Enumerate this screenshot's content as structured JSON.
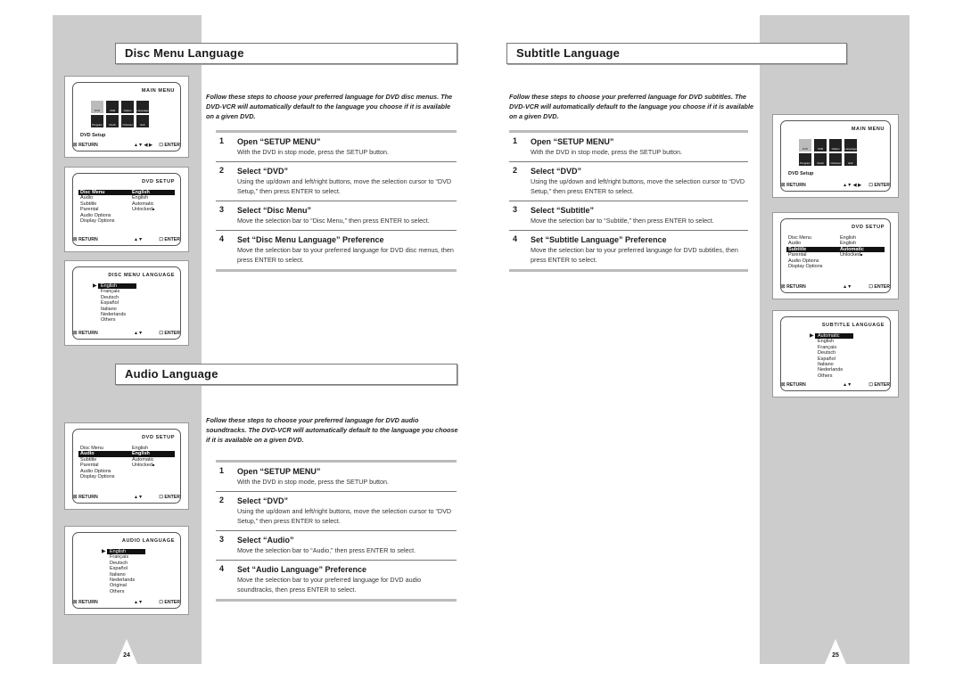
{
  "pages": [
    {
      "number": "24"
    },
    {
      "number": "25"
    }
  ],
  "sections": {
    "disc_menu": {
      "title": "Disc Menu Language",
      "intro": "Follow these steps to choose your preferred language for DVD disc menus. The DVD-VCR will automatically default to the language you choose if it is available on a given DVD.",
      "steps": [
        {
          "num": "1",
          "heading": "Open “SETUP MENU”",
          "text": "With the DVD in stop mode, press the SETUP button."
        },
        {
          "num": "2",
          "heading": "Select “DVD”",
          "text": "Using the up/down and left/right buttons, move the selection cursor to “DVD Setup,” then press ENTER to select."
        },
        {
          "num": "3",
          "heading": "Select “Disc Menu”",
          "text": "Move the selection bar to “Disc Menu,” then press ENTER to select."
        },
        {
          "num": "4",
          "heading": "Set “Disc Menu Language” Preference",
          "text": "Move the selection bar to your preferred language for DVD disc menus, then press ENTER to select."
        }
      ]
    },
    "audio": {
      "title": "Audio Language",
      "intro": "Follow these steps to choose your preferred language for DVD audio soundtracks. The DVD-VCR will automatically default to the language you choose if it is available on a given DVD.",
      "steps": [
        {
          "num": "1",
          "heading": "Open “SETUP MENU”",
          "text": "With the DVD in stop mode, press the SETUP button."
        },
        {
          "num": "2",
          "heading": "Select “DVD”",
          "text": "Using the up/down and left/right buttons, move the selection cursor to “DVD Setup,” then press ENTER to select."
        },
        {
          "num": "3",
          "heading": "Select “Audio”",
          "text": "Move the selection bar to “Audio,” then press ENTER to select."
        },
        {
          "num": "4",
          "heading": "Set “Audio Language” Preference",
          "text": "Move the selection bar to your preferred language for DVD audio soundtracks, then press ENTER to select."
        }
      ]
    },
    "subtitle": {
      "title": "Subtitle Language",
      "intro": "Follow these steps to choose your preferred language for DVD subtitles. The DVD-VCR will automatically default to the language you choose if it is available on a given DVD.",
      "steps": [
        {
          "num": "1",
          "heading": "Open “SETUP MENU”",
          "text": "With the DVD in stop mode, press the SETUP button."
        },
        {
          "num": "2",
          "heading": "Select “DVD”",
          "text": "Using the up/down and left/right buttons, move the selection cursor to “DVD Setup,” then press ENTER to select."
        },
        {
          "num": "3",
          "heading": "Select “Subtitle”",
          "text": "Move the selection bar to “Subtitle,” then press ENTER to select."
        },
        {
          "num": "4",
          "heading": "Set “Subtitle Language” Preference",
          "text": "Move the selection bar to your preferred language for DVD subtitles, then press ENTER to select."
        }
      ]
    }
  },
  "screens": {
    "main_menu": {
      "title": "MAIN MENU",
      "icons": [
        {
          "label": "DVD",
          "icon": "disc-icon"
        },
        {
          "label": "VCR",
          "icon": "vcr-icon"
        },
        {
          "label": "Option",
          "icon": "option-icon"
        },
        {
          "label": "Language",
          "icon": "globe-icon"
        },
        {
          "label": "Program",
          "icon": "program-icon"
        },
        {
          "label": "Clock",
          "icon": "clock-icon"
        },
        {
          "label": "Channel",
          "icon": "antenna-icon"
        },
        {
          "label": "Exit",
          "icon": "exit-icon"
        }
      ],
      "caption": "DVD Setup",
      "return": "RETURN",
      "nav": "▲▼ ◀ ▶",
      "enter": "ENTER"
    },
    "dvd_setup": {
      "title": "DVD SETUP",
      "rows": [
        {
          "key": "Disc Menu",
          "value": "English"
        },
        {
          "key": "Audio",
          "value": "English"
        },
        {
          "key": "Subtitle",
          "value": "Automatic"
        },
        {
          "key": "Parental",
          "value": "Unlocked"
        },
        {
          "key": "Audio Options",
          "value": ""
        },
        {
          "key": "Display Options",
          "value": ""
        }
      ],
      "lock_icon": "🔓",
      "return": "RETURN",
      "nav": "▲▼",
      "enter": "ENTER"
    },
    "disc_menu_language": {
      "title": "DISC MENU LANGUAGE",
      "items": [
        "English",
        "Français",
        "Deutsch",
        "Español",
        "Italiano",
        "Nederlands",
        "Others"
      ],
      "return": "RETURN",
      "nav": "▲▼",
      "enter": "ENTER"
    },
    "audio_language": {
      "title": "AUDIO LANGUAGE",
      "items": [
        "English",
        "Français",
        "Deutsch",
        "Español",
        "Italiano",
        "Nederlands",
        "Original",
        "Others"
      ],
      "return": "RETURN",
      "nav": "▲▼",
      "enter": "ENTER"
    },
    "subtitle_language": {
      "title": "SUBTITLE LANGUAGE",
      "items": [
        "Automatic",
        "English",
        "Français",
        "Deutsch",
        "Español",
        "Italiano",
        "Nederlands",
        "Others"
      ],
      "return": "RETURN",
      "nav": "▲▼",
      "enter": "ENTER"
    }
  }
}
